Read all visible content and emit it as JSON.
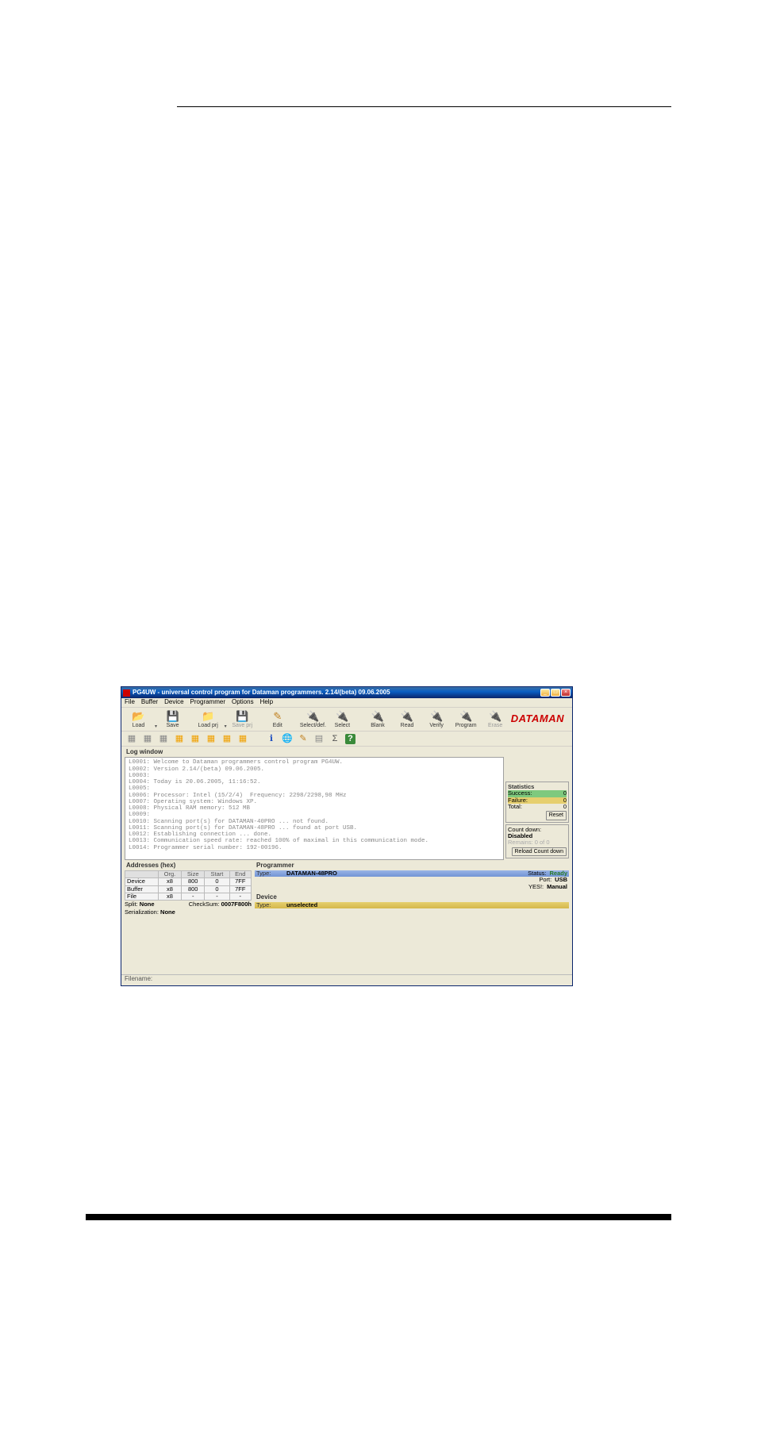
{
  "window": {
    "title": "PG4UW - universal control program for Dataman programmers. 2.14/(beta) 09.06.2005"
  },
  "menu": [
    "File",
    "Buffer",
    "Device",
    "Programmer",
    "Options",
    "Help"
  ],
  "toolbar": [
    {
      "label": "Load",
      "icon": "📂",
      "enabled": true,
      "name": "load-button"
    },
    {
      "label": "Save",
      "icon": "💾",
      "enabled": true,
      "name": "save-button"
    },
    {
      "label": "Load prj",
      "icon": "📂",
      "enabled": true,
      "name": "load-prj-button"
    },
    {
      "label": "Save prj",
      "icon": "💾",
      "enabled": false,
      "name": "save-prj-button"
    },
    {
      "label": "Edit",
      "icon": "✎",
      "enabled": true,
      "name": "edit-button"
    },
    {
      "label": "Select/def.",
      "icon": "🔧",
      "enabled": true,
      "name": "select-def-button"
    },
    {
      "label": "Select",
      "icon": "🔧",
      "enabled": true,
      "name": "select-button"
    },
    {
      "label": "Blank",
      "icon": "🔧",
      "enabled": true,
      "name": "blank-button"
    },
    {
      "label": "Read",
      "icon": "🔧",
      "enabled": true,
      "name": "read-button"
    },
    {
      "label": "Verify",
      "icon": "🔧",
      "enabled": true,
      "name": "verify-button"
    },
    {
      "label": "Program",
      "icon": "🔧",
      "enabled": true,
      "name": "program-button"
    },
    {
      "label": "Erase",
      "icon": "🔧",
      "enabled": false,
      "name": "erase-button"
    }
  ],
  "brand": "DATAMAN",
  "logwindow": {
    "title": "Log window",
    "lines": [
      {
        "n": "L0001:",
        "t": "Welcome to Dataman programmers control program PG4UW."
      },
      {
        "n": "L0002:",
        "t": "Version 2.14/(beta) 09.06.2005."
      },
      {
        "n": "L0003:",
        "t": ""
      },
      {
        "n": "L0004:",
        "t": "Today is 20.06.2005, 11:16:52."
      },
      {
        "n": "L0005:",
        "t": ""
      },
      {
        "n": "L0006:",
        "t": "Processor: Intel (15/2/4)  Frequency: 2298/2298,98 MHz"
      },
      {
        "n": "L0007:",
        "t": "Operating system: Windows XP."
      },
      {
        "n": "L0008:",
        "t": "Physical RAM memory: 512 MB"
      },
      {
        "n": "L0009:",
        "t": ""
      },
      {
        "n": "L0010:",
        "t": "Scanning port(s) for DATAMAN-40PRO ... not found."
      },
      {
        "n": "L0011:",
        "t": "Scanning port(s) for DATAMAN-48PRO ... found at port USB."
      },
      {
        "n": "L0012:",
        "t": "Establishing connection ... done."
      },
      {
        "n": "L0013:",
        "t": "Communication speed rate: reached 100% of maximal in this communication mode."
      },
      {
        "n": "L0014:",
        "t": "Programmer serial number: 192-00196."
      }
    ]
  },
  "stats": {
    "title": "Statistics",
    "success_label": "Success:",
    "success": "0",
    "failure_label": "Failure:",
    "failure": "0",
    "total_label": "Total:",
    "total": "0",
    "reset": "Reset",
    "countdown_label": "Count down:",
    "countdown": "Disabled",
    "remains": "Remains: 0 of 0",
    "reload": "Reload Count down"
  },
  "addresses": {
    "title": "Addresses (hex)",
    "headers": [
      "",
      "Org.",
      "Size",
      "Start",
      "End"
    ],
    "rows": [
      [
        "Device",
        "x8",
        "800",
        "0",
        "7FF"
      ],
      [
        "Buffer",
        "x8",
        "800",
        "0",
        "7FF"
      ],
      [
        "File",
        "x8",
        "-",
        "-",
        "-"
      ]
    ],
    "split_label": "Split:",
    "split": "None",
    "checksum_label": "CheckSum:",
    "checksum": "0007F800h",
    "serial_label": "Serialization:",
    "serial": "None"
  },
  "programmer": {
    "title": "Programmer",
    "type_label": "Type:",
    "type": "DATAMAN-48PRO",
    "status_label": "Status:",
    "status": "Ready",
    "port_label": "Port:",
    "port": "USB",
    "yes_label": "YES!:",
    "yes": "Manual"
  },
  "device": {
    "title": "Device",
    "type_label": "Type:",
    "type": "unselected"
  },
  "statusbar": {
    "filename_label": "Filename:"
  }
}
